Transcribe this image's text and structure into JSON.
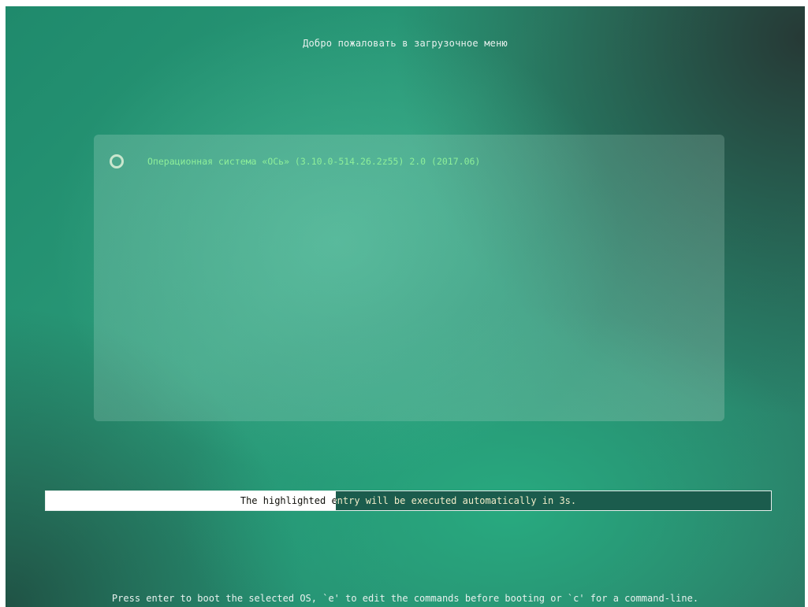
{
  "title": "Добро пожаловать в загрузочное меню",
  "menu": {
    "entries": [
      {
        "label": "Операционная система «ОСь» (3.10.0-514.26.2z55) 2.0 (2017.06)",
        "icon": "os-circle-icon",
        "selected": true
      }
    ]
  },
  "timeout": {
    "text": "The highlighted entry will be executed automatically in 3s.",
    "progress_fraction": 0.4,
    "seconds_remaining": 3
  },
  "help": {
    "text": "Press enter to boot the selected OS, `e' to edit the commands before booting or `c' for a command-line."
  },
  "colors": {
    "accent_text": "#8eef9a",
    "timeout_bg": "#1b5c4d",
    "timeout_fill": "#ffffff"
  }
}
